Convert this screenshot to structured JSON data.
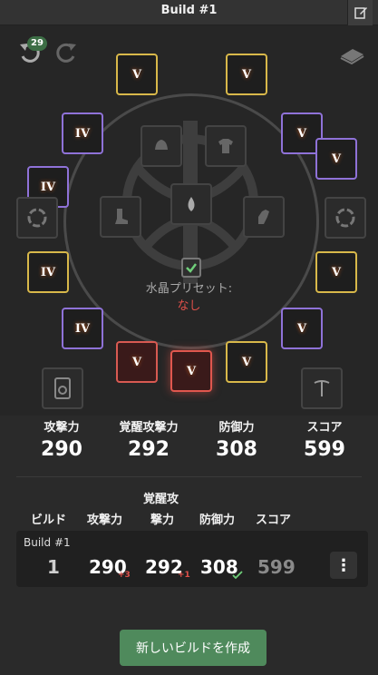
{
  "window": {
    "title": "Build #1"
  },
  "toolbar": {
    "undo_count": "29"
  },
  "gear": {
    "slots": [
      {
        "slot": "helmet",
        "tier": "gold",
        "level": "V"
      },
      {
        "slot": "armor",
        "tier": "gold",
        "level": "V"
      },
      {
        "slot": "ring-left",
        "tier": "purple",
        "level": "IV"
      },
      {
        "slot": "necklace",
        "tier": "purple",
        "level": "V"
      },
      {
        "slot": "ring-left-2",
        "tier": "purple",
        "level": "IV"
      },
      {
        "slot": "earring",
        "tier": "gold",
        "level": "IV"
      },
      {
        "slot": "boots",
        "tier": "gold",
        "level": "V"
      },
      {
        "slot": "gloves",
        "tier": "gold",
        "level": "V"
      },
      {
        "slot": "belt",
        "tier": "purple",
        "level": "IV"
      },
      {
        "slot": "ring-right",
        "tier": "purple",
        "level": "V"
      },
      {
        "slot": "main-weapon",
        "tier": "red",
        "level": "V"
      },
      {
        "slot": "awakening-weapon",
        "tier": "red",
        "level": "V"
      },
      {
        "slot": "sub-weapon",
        "tier": "gold",
        "level": "V"
      }
    ],
    "crystal_preset_label": "水晶プリセット:",
    "crystal_preset_value": "なし"
  },
  "stats": [
    {
      "label": "攻撃力",
      "value": "290"
    },
    {
      "label": "覚醒攻撃力",
      "value": "292"
    },
    {
      "label": "防御力",
      "value": "308"
    },
    {
      "label": "スコア",
      "value": "599"
    }
  ],
  "table": {
    "headers": {
      "build": "ビルド",
      "ap": "攻撃力",
      "aap_line1": "覚醒攻",
      "aap_line2": "撃力",
      "dp": "防御力",
      "score": "スコア"
    },
    "rows": [
      {
        "name": "Build #1",
        "index": "1",
        "ap": "290",
        "ap_delta": "+3",
        "aap": "292",
        "aap_delta": "+1",
        "dp": "308",
        "score": "599"
      }
    ],
    "menu_icon": "⋮"
  },
  "actions": {
    "create_label": "新しいビルドを作成"
  },
  "colors": {
    "gold_border": "#d8b84a",
    "purple_border": "#8f72d8",
    "red_border": "#e0574e",
    "accent_green": "#4f8a5c",
    "negative_red": "#e0504a"
  }
}
